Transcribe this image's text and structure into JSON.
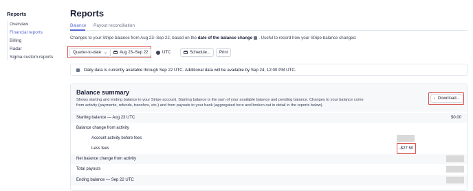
{
  "sidebar": {
    "title": "Reports",
    "items": [
      {
        "label": "Overview",
        "active": false
      },
      {
        "label": "Financial reports",
        "active": true
      },
      {
        "label": "Billing",
        "active": false
      },
      {
        "label": "Radar",
        "active": false
      },
      {
        "label": "Sigma custom reports",
        "active": false
      }
    ]
  },
  "header": {
    "title": "Reports",
    "tabs": [
      {
        "label": "Balance",
        "active": true
      },
      {
        "label": "Payout reconciliation",
        "active": false
      }
    ]
  },
  "description": {
    "prefix": "Changes to your Stripe balance from ",
    "range": "Aug 23–Sep 22",
    "middle": ", based on the ",
    "emph": "date of the balance change",
    "suffix": ". Useful to record how your Stripe balance changed."
  },
  "controls": {
    "period_label": "Quarter-to-date",
    "date_range": "Aug 23–Sep 22",
    "timezone": "UTC",
    "schedule_label": "Schedule...",
    "print_label": "Print"
  },
  "banner": {
    "text": "Daily data is currently available through Sep 22 UTC. Additional data will be available by Sep 24, 12:00 PM UTC."
  },
  "balance_summary": {
    "title": "Balance summary",
    "description": "Shows starting and ending balance in your Stripe account. Starting balance is the sum of your available balance and pending balance. Changes to your balance come from activity (payments, refunds, transfers, etc.) and from payouts to your bank (aggregated here and broken out in detail in the reports below).",
    "download_label": "Download...",
    "rows": [
      {
        "label": "Starting balance — Aug 23 UTC",
        "value": "$0.00"
      },
      {
        "label": "Balance change from activity",
        "value": ""
      },
      {
        "label": "Account activity before fees",
        "value": ""
      },
      {
        "label": "Less fees",
        "value": "-$27.50"
      },
      {
        "label": "Net balance change from activity",
        "value": ""
      },
      {
        "label": "Total payouts",
        "value": ""
      },
      {
        "label": "Ending balance — Sep 22 UTC",
        "value": ""
      }
    ]
  },
  "colors": {
    "accent": "#5469d4",
    "highlight": "#d9534f",
    "text": "#1a1f36",
    "muted": "#697386"
  }
}
